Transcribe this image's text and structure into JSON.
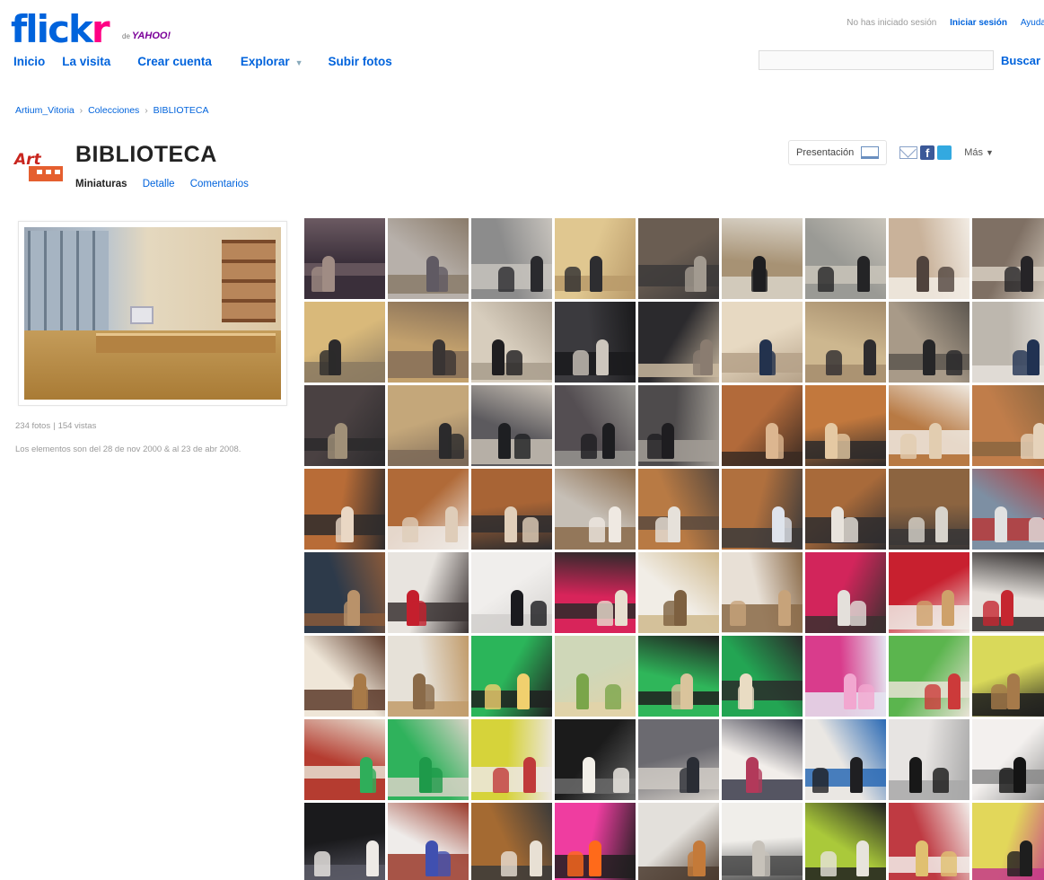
{
  "brand": {
    "name_main": "flick",
    "name_r": "r",
    "by": "de",
    "partner": "YAHOO!",
    "colors": {
      "blue": "#0063dc",
      "pink": "#ff0084",
      "purple": "#7b0099"
    }
  },
  "nav": {
    "items": [
      "Inicio",
      "La visita",
      "Crear cuenta",
      "Explorar",
      "Subir fotos"
    ]
  },
  "user_nav": {
    "status": "No has iniciado sesión",
    "login": "Iniciar sesión",
    "help": "Ayuda"
  },
  "search": {
    "value": "",
    "button": "Buscar"
  },
  "breadcrumb": [
    "Artium_Vitoria",
    "Colecciones",
    "BIBLIOTECA"
  ],
  "collection": {
    "title": "BIBLIOTECA",
    "tabs": [
      "Miniaturas",
      "Detalle",
      "Comentarios"
    ],
    "active_tab": "Miniaturas",
    "stats_photos": "234 fotos",
    "stats_views": "154 vistas",
    "date_range": "Los elementos son del 28 de nov 2000 & al 23 de abr 2008."
  },
  "tools": {
    "slideshow": "Presentación",
    "more": "Más",
    "icons": [
      "mail-icon",
      "facebook-icon",
      "twitter-icon",
      "slideshow-icon"
    ]
  },
  "thumbnails": {
    "icon": "photo-thumbnail",
    "palettes": [
      [
        "#3a2f3a",
        "#a08c84",
        "#6c5a62"
      ],
      [
        "#b7b0aa",
        "#605a63",
        "#8a7b6a"
      ],
      [
        "#8c8c8c",
        "#2a2a2e",
        "#c7c3bd"
      ],
      [
        "#e0c790",
        "#2d2d30",
        "#b99a6a"
      ],
      [
        "#6a5d52",
        "#a29a90",
        "#3c3a3a"
      ],
      [
        "#a79274",
        "#1e1e20",
        "#d9d3c8"
      ],
      [
        "#9a9a95",
        "#242426",
        "#c9c4ba"
      ],
      [
        "#c9b29a",
        "#50433d",
        "#f2ece4"
      ],
      [
        "#7f7064",
        "#262427",
        "#d8cfc2"
      ],
      [
        "#d9b97a",
        "#2c2a2b",
        "#8b7a62"
      ],
      [
        "#c3a16d",
        "#3a3533",
        "#866f58"
      ],
      [
        "#d7cdbd",
        "#1f1e20",
        "#a89c8c"
      ],
      [
        "#3b3a3e",
        "#cdc6bd",
        "#1a1a1c"
      ],
      [
        "#2b2a2d",
        "#8a7c70",
        "#c8b79f"
      ],
      [
        "#e7d9c2",
        "#23324e",
        "#b5a188"
      ],
      [
        "#cdb78f",
        "#2e2c2e",
        "#a58d6d"
      ],
      [
        "#a89a88",
        "#262628",
        "#5c564f"
      ],
      [
        "#bdb7ae",
        "#213252",
        "#e6e2dc"
      ],
      [
        "#4a4142",
        "#a09078",
        "#2b2a2c"
      ],
      [
        "#c4a77a",
        "#2b2a2c",
        "#7d6a58"
      ],
      [
        "#5c5a5e",
        "#1e1f22",
        "#c6beb3"
      ],
      [
        "#544e52",
        "#1d1d20",
        "#96948f"
      ],
      [
        "#4e4b4c",
        "#1e1d20",
        "#a39e96"
      ],
      [
        "#b26a3a",
        "#dcb690",
        "#3a2a22"
      ],
      [
        "#c2783d",
        "#e5c9a3",
        "#2d2a2a"
      ],
      [
        "#b87a44",
        "#e2cdb0",
        "#efe9e0"
      ],
      [
        "#c07d4a",
        "#e6d3bb",
        "#8a6540"
      ],
      [
        "#b86c37",
        "#e9d7c4",
        "#2e2b2c"
      ],
      [
        "#b06a38",
        "#dfcdb9",
        "#efeae5"
      ],
      [
        "#a86435",
        "#e1cfba",
        "#2e2d2f"
      ],
      [
        "#c6bfb6",
        "#efe9e2",
        "#8a6a4a"
      ],
      [
        "#b87a44",
        "#e6e1da",
        "#5a4a3e"
      ],
      [
        "#b0703e",
        "#dfe3ec",
        "#3c3a3a"
      ],
      [
        "#a86a3a",
        "#e8e3dc",
        "#2e2d2f"
      ],
      [
        "#8c6440",
        "#d8d4cc",
        "#3a3737"
      ],
      [
        "#7d8fa3",
        "#e1e1e1",
        "#b63a3a"
      ],
      [
        "#2d3a4a",
        "#b9926a",
        "#8a5a3a"
      ],
      [
        "#e8e4df",
        "#c41f2d",
        "#3a3232"
      ],
      [
        "#f0eeec",
        "#1a1a1e",
        "#d1cfcc"
      ],
      [
        "#d8245a",
        "#e8dfd0",
        "#2c2a2a"
      ],
      [
        "#f1ede6",
        "#7d6040",
        "#cfb88c"
      ],
      [
        "#e8e0d6",
        "#c7a37a",
        "#8a6a48"
      ],
      [
        "#d2255b",
        "#e4e0db",
        "#3a3030"
      ],
      [
        "#c8202f",
        "#cea16a",
        "#f0ece6"
      ],
      [
        "#e7e3de",
        "#c5262f",
        "#2e2a2a"
      ],
      [
        "#efe6d8",
        "#a87a48",
        "#5c3a2a"
      ],
      [
        "#e6e1d8",
        "#8a6a48",
        "#c19b6a"
      ],
      [
        "#2bb55a",
        "#f1d06e",
        "#202020"
      ],
      [
        "#cfd7b8",
        "#7aa54a",
        "#e2d2a8"
      ],
      [
        "#2fb65a",
        "#d9c49c",
        "#1f1f1f"
      ],
      [
        "#23a553",
        "#e9dcc3",
        "#2a2a2a"
      ],
      [
        "#d93c8c",
        "#f2a7d0",
        "#e4e4f0"
      ],
      [
        "#5bb54e",
        "#cc3a3a",
        "#e9e3d6"
      ],
      [
        "#d9d95a",
        "#a67a4a",
        "#1e1e1e"
      ],
      [
        "#b53c30",
        "#2fae5a",
        "#e7e0d2"
      ],
      [
        "#2fb25c",
        "#1e9a4a",
        "#d8d2c6"
      ],
      [
        "#d6d33a",
        "#c03a3a",
        "#ece6e0"
      ],
      [
        "#1b1b1b",
        "#f2efe8",
        "#6a6a6a"
      ],
      [
        "#6b6a70",
        "#2a2d35",
        "#cfcac4"
      ],
      [
        "#f2eeea",
        "#b23a5a",
        "#3a3a4a"
      ],
      [
        "#eae7e3",
        "#1f1f22",
        "#2a6ab5"
      ],
      [
        "#e7e4e2",
        "#181818",
        "#a8a8a8"
      ],
      [
        "#f3f0ee",
        "#141414",
        "#8a8a8a"
      ],
      [
        "#1a1a1c",
        "#eeeae6",
        "#5a5a66"
      ],
      [
        "#efecea",
        "#4050b0",
        "#9a3a2a"
      ],
      [
        "#a46a32",
        "#e8e0d4",
        "#3a3a3a"
      ],
      [
        "#ef3da0",
        "#ff6a1a",
        "#1e1e1e"
      ],
      [
        "#e3e0db",
        "#c47a3a",
        "#4a3a2e"
      ],
      [
        "#f0eeea",
        "#c7c2ba",
        "#4b4b4b"
      ],
      [
        "#aac93a",
        "#e7e4dc",
        "#202020"
      ],
      [
        "#bf3a42",
        "#e0c070",
        "#f2eeea"
      ],
      [
        "#e2d75a",
        "#1e1e1e",
        "#c43a8a"
      ]
    ]
  }
}
